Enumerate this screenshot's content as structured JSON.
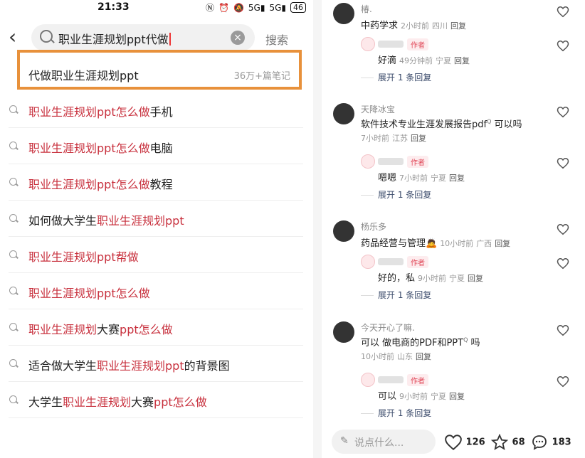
{
  "status_bar": {
    "time": "21:33",
    "battery": "46",
    "icons": [
      "nfc-icon",
      "alarm-icon",
      "mute-icon",
      "5g-icon",
      "5g-icon"
    ]
  },
  "search": {
    "query": "职业生涯规划ppt代做",
    "button_label": "搜索"
  },
  "top_suggestion": {
    "text": "代做职业生涯规划ppt",
    "count": "36万+篇笔记"
  },
  "suggestions": [
    {
      "parts": [
        {
          "t": "职业生涯规划ppt怎么",
          "h": true
        },
        {
          "t": "做",
          "h": true
        },
        {
          "t": "手机",
          "h": false
        }
      ]
    },
    {
      "parts": [
        {
          "t": "职业生涯规划ppt怎么",
          "h": true
        },
        {
          "t": "做",
          "h": true
        },
        {
          "t": "电脑",
          "h": false
        }
      ]
    },
    {
      "parts": [
        {
          "t": "职业生涯规划ppt怎么",
          "h": true
        },
        {
          "t": "做",
          "h": true
        },
        {
          "t": "教程",
          "h": false
        }
      ]
    },
    {
      "parts": [
        {
          "t": "如何做大学生",
          "h": false
        },
        {
          "t": "职业生涯规划ppt",
          "h": true
        }
      ]
    },
    {
      "parts": [
        {
          "t": "职业生涯规划ppt帮",
          "h": true
        },
        {
          "t": "做",
          "h": true
        }
      ]
    },
    {
      "parts": [
        {
          "t": "职业生涯规划ppt怎么",
          "h": true
        },
        {
          "t": "做",
          "h": true
        }
      ]
    },
    {
      "parts": [
        {
          "t": "职业生涯规划",
          "h": true
        },
        {
          "t": "大赛",
          "h": false
        },
        {
          "t": "ppt怎么",
          "h": true
        },
        {
          "t": "做",
          "h": true
        }
      ]
    },
    {
      "parts": [
        {
          "t": "适合做大学生",
          "h": false
        },
        {
          "t": "职业生涯规划ppt",
          "h": true
        },
        {
          "t": "的背景图",
          "h": false
        }
      ]
    },
    {
      "parts": [
        {
          "t": "大学生",
          "h": false
        },
        {
          "t": "职业生涯规划",
          "h": true
        },
        {
          "t": "大赛",
          "h": false
        },
        {
          "t": "ppt怎么",
          "h": true
        },
        {
          "t": "做",
          "h": true
        }
      ]
    }
  ],
  "comments": [
    {
      "user": "椿.",
      "text": "中药学求",
      "time": "2小时前",
      "region": "四川",
      "reply": "回复",
      "sub": {
        "badge": "作者",
        "text": "好滴",
        "time": "49分钟前",
        "region": "宁夏",
        "reply": "回复"
      },
      "expand": "展开 1 条回复"
    },
    {
      "user": "天降冰宝",
      "text": "软件技术专业生涯发展报告pdf",
      "text_tail": "可以吗",
      "time": "7小时前",
      "region": "江苏",
      "reply": "回复",
      "sub": {
        "badge": "作者",
        "text": "嗯嗯",
        "time": "7小时前",
        "region": "宁夏",
        "reply": "回复"
      },
      "expand": "展开 1 条回复"
    },
    {
      "user": "杨乐多",
      "text": "药品经营与管理🙇",
      "time": "10小时前",
      "region": "广西",
      "reply": "回复",
      "sub": {
        "badge": "作者",
        "text": "好的，私",
        "time": "9小时前",
        "region": "宁夏",
        "reply": "回复"
      },
      "expand": "展开 1 条回复"
    },
    {
      "user": "今天开心了嘛.",
      "text": "可以 做电商的PDF和PPT",
      "text_tail": "吗",
      "time": "10小时前",
      "region": "山东",
      "reply": "回复",
      "sub": {
        "badge": "作者",
        "text": "可以",
        "time": "9小时前",
        "region": "宁夏",
        "reply": "回复"
      },
      "expand": "展开 1 条回复"
    }
  ],
  "bottom_bar": {
    "placeholder": "说点什么...",
    "likes": "126",
    "favorites": "68",
    "comments": "183"
  }
}
